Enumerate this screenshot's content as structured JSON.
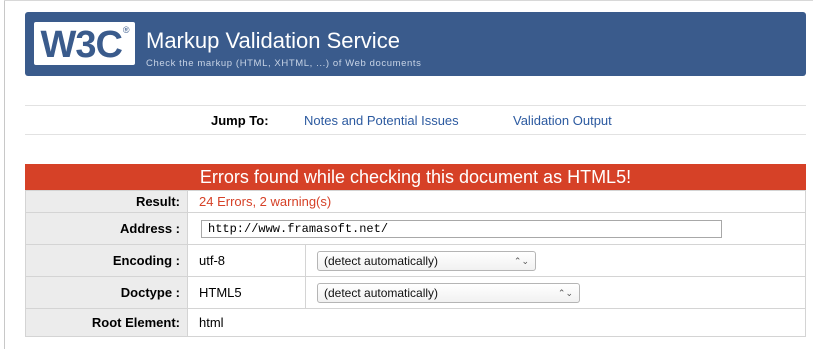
{
  "header": {
    "logo_text": "W3C",
    "logo_reg": "®",
    "title": "Markup Validation Service",
    "subtitle": "Check the markup (HTML, XHTML, ...) of Web documents"
  },
  "jump": {
    "label": "Jump To:",
    "links": [
      "Notes and Potential Issues",
      "Validation Output"
    ]
  },
  "banner": {
    "message": "Errors found while checking this document as HTML5!"
  },
  "results": {
    "result_label": "Result:",
    "result_value": "24 Errors, 2 warning(s)",
    "address_label": "Address :",
    "address_value": "http://www.framasoft.net/",
    "encoding_label": "Encoding :",
    "encoding_value": "utf-8",
    "encoding_select": "(detect automatically)",
    "doctype_label": "Doctype :",
    "doctype_value": "HTML5",
    "doctype_select": "(detect automatically)",
    "root_label": "Root Element:",
    "root_value": "html"
  },
  "colors": {
    "banner_blue": "#3a5b8c",
    "error_red": "#d64127",
    "link_blue": "#2c5aa0"
  },
  "icons": {
    "select_arrow": "select-arrows-icon"
  }
}
